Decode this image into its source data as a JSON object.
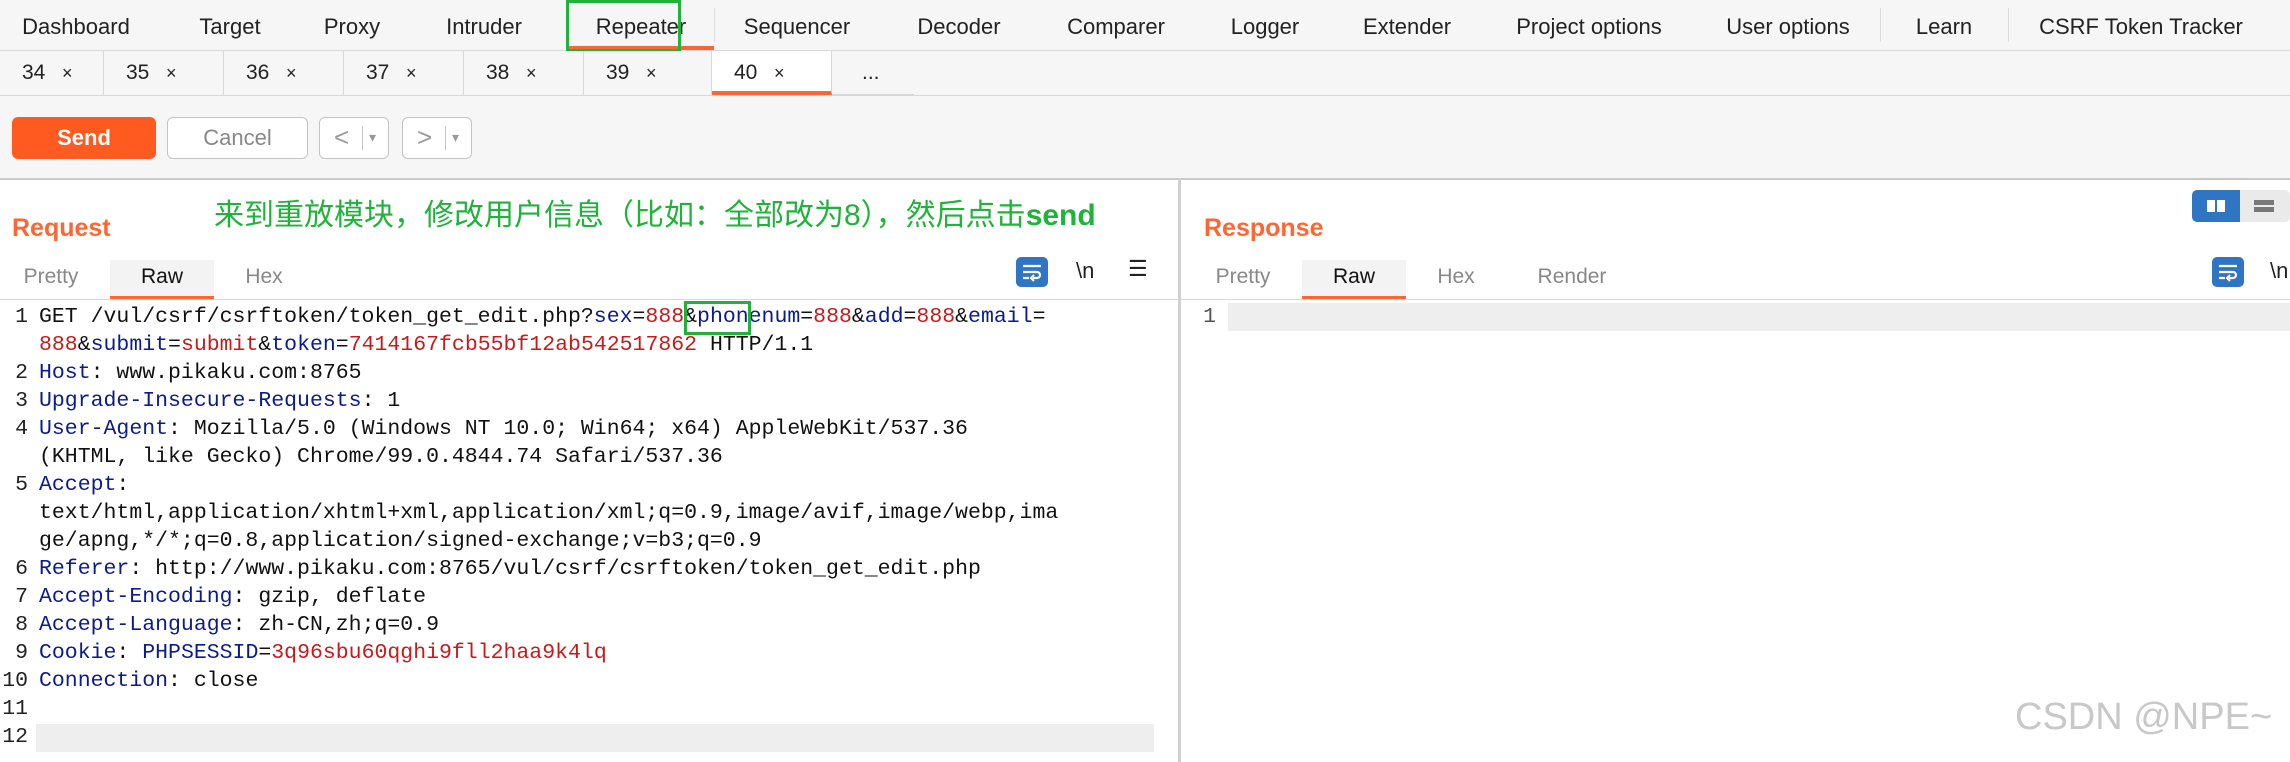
{
  "topnav": {
    "items": [
      "Dashboard",
      "Target",
      "Proxy",
      "Intruder",
      "Repeater",
      "Sequencer",
      "Decoder",
      "Comparer",
      "Logger",
      "Extender",
      "Project options",
      "User options",
      "Learn",
      "CSRF Token Tracker"
    ],
    "active": "Repeater"
  },
  "request_tabs": {
    "items": [
      {
        "num": "34",
        "close": "×"
      },
      {
        "num": "35",
        "close": "×"
      },
      {
        "num": "36",
        "close": "×"
      },
      {
        "num": "37",
        "close": "×"
      },
      {
        "num": "38",
        "close": "×"
      },
      {
        "num": "39",
        "close": "×"
      },
      {
        "num": "40",
        "close": "×"
      }
    ],
    "more": "...",
    "active": "40"
  },
  "toolbar": {
    "send_label": "Send",
    "cancel_label": "Cancel",
    "back_arrow": "<",
    "forward_arrow": ">",
    "dropdown": "▾"
  },
  "request": {
    "title": "Request",
    "annotation_text": "来到重放模块，修改用户信息（比如：全部改为8），然后点击",
    "annotation_bold": "send",
    "tabs": [
      "Pretty",
      "Raw",
      "Hex"
    ],
    "active_tab": "Raw",
    "newline_label": "\\n",
    "menu_icon": "☰",
    "lines": [
      {
        "n": "1",
        "segs": [
          [
            "",
            "GET /vul/csrf/csrftoken/token_get_edit.php?"
          ],
          [
            "k",
            "sex"
          ],
          [
            "",
            "="
          ],
          [
            "v",
            "888"
          ],
          [
            "",
            "&"
          ],
          [
            "k",
            "phonenum"
          ],
          [
            "",
            "="
          ],
          [
            "v",
            "888"
          ],
          [
            "",
            "&"
          ],
          [
            "k",
            "add"
          ],
          [
            "",
            "="
          ],
          [
            "v",
            "888"
          ],
          [
            "",
            "&"
          ],
          [
            "k",
            "email"
          ],
          [
            "",
            "="
          ]
        ]
      },
      {
        "n": "",
        "segs": [
          [
            "v",
            "888"
          ],
          [
            "",
            "&"
          ],
          [
            "k",
            "submit"
          ],
          [
            "",
            "="
          ],
          [
            "v",
            "submit"
          ],
          [
            "",
            "&"
          ],
          [
            "k",
            "token"
          ],
          [
            "",
            "="
          ],
          [
            "v",
            "7414167fcb55bf12ab542517862"
          ],
          [
            "",
            " HTTP/1.1"
          ]
        ]
      },
      {
        "n": "2",
        "segs": [
          [
            "k",
            "Host"
          ],
          [
            "",
            ": www.pikaku.com:8765"
          ]
        ]
      },
      {
        "n": "3",
        "segs": [
          [
            "k",
            "Upgrade-Insecure-Requests"
          ],
          [
            "",
            ": 1"
          ]
        ]
      },
      {
        "n": "4",
        "segs": [
          [
            "k",
            "User-Agent"
          ],
          [
            "",
            ": Mozilla/5.0 (Windows NT 10.0; Win64; x64) AppleWebKit/537.36"
          ]
        ]
      },
      {
        "n": "",
        "segs": [
          [
            "",
            "(KHTML, like Gecko) Chrome/99.0.4844.74 Safari/537.36"
          ]
        ]
      },
      {
        "n": "5",
        "segs": [
          [
            "k",
            "Accept"
          ],
          [
            "",
            ":"
          ]
        ]
      },
      {
        "n": "",
        "segs": [
          [
            "",
            "text/html,application/xhtml+xml,application/xml;q=0.9,image/avif,image/webp,ima"
          ]
        ]
      },
      {
        "n": "",
        "segs": [
          [
            "",
            "ge/apng,*/*;q=0.8,application/signed-exchange;v=b3;q=0.9"
          ]
        ]
      },
      {
        "n": "6",
        "segs": [
          [
            "k",
            "Referer"
          ],
          [
            "",
            ": http://www.pikaku.com:8765/vul/csrf/csrftoken/token_get_edit.php"
          ]
        ]
      },
      {
        "n": "7",
        "segs": [
          [
            "k",
            "Accept-Encoding"
          ],
          [
            "",
            ": gzip, deflate"
          ]
        ]
      },
      {
        "n": "8",
        "segs": [
          [
            "k",
            "Accept-Language"
          ],
          [
            "",
            ": zh-CN,zh;q=0.9"
          ]
        ]
      },
      {
        "n": "9",
        "segs": [
          [
            "k",
            "Cookie"
          ],
          [
            "",
            ": "
          ],
          [
            "k",
            "PHPSESSID"
          ],
          [
            "",
            "="
          ],
          [
            "v",
            "3q96sbu60qghi9fll2haa9k4lq"
          ]
        ]
      },
      {
        "n": "10",
        "segs": [
          [
            "k",
            "Connection"
          ],
          [
            "",
            ": close"
          ]
        ]
      },
      {
        "n": "11",
        "segs": []
      },
      {
        "n": "12",
        "segs": []
      }
    ]
  },
  "response": {
    "title": "Response",
    "tabs": [
      "Pretty",
      "Raw",
      "Hex",
      "Render"
    ],
    "active_tab": "Raw",
    "newline_label": "\\n",
    "line_number": "1"
  },
  "watermark": "CSDN @NPE~",
  "colors": {
    "accent": "#ff6633",
    "annotation": "#1fb33a",
    "key": "#0a1b8c",
    "value": "#c71a1a",
    "icon_blue": "#2e76c3"
  }
}
